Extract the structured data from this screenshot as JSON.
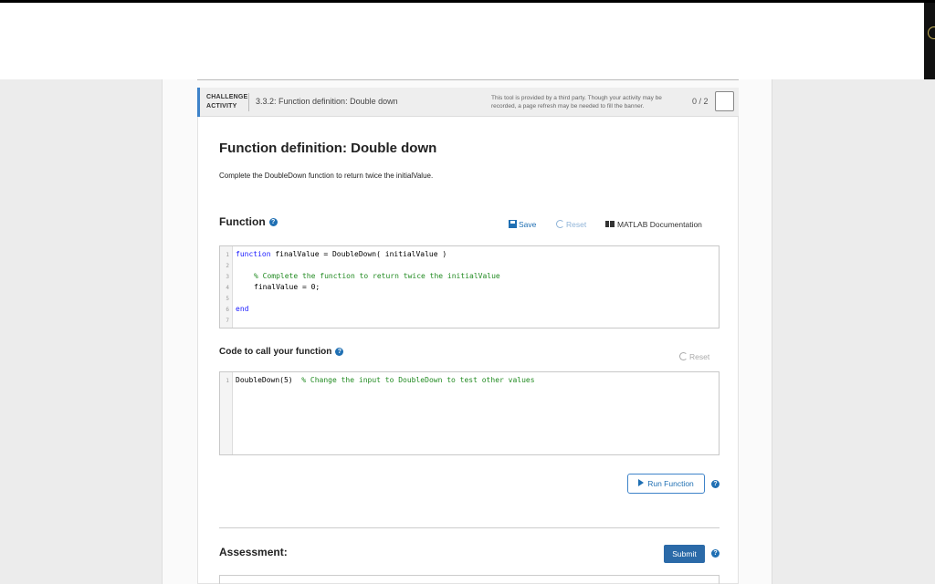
{
  "activity": {
    "type_line1": "CHALLENGE",
    "type_line2": "ACTIVITY",
    "title": "3.3.2: Function definition: Double down",
    "notice": "This tool is provided by a third party. Though your activity may be recorded, a page refresh may be needed to fill the banner.",
    "progress": "0 / 2"
  },
  "heading": "Function definition: Double down",
  "instructions": "Complete the DoubleDown function to return twice the initialValue.",
  "function_section": {
    "label": "Function",
    "save_label": "Save",
    "reset_label": "Reset",
    "doc_label": "MATLAB Documentation",
    "line_numbers": [
      "1",
      "2",
      "3",
      "4",
      "5",
      "6",
      "7"
    ],
    "line1_kw": "function",
    "line1_rest": " finalValue = DoubleDown( initialValue )",
    "line3_comment": "% Complete the function to return twice the initialValue",
    "line4_code": "finalValue = 0;",
    "line6_kw": "end"
  },
  "call_section": {
    "label": "Code to call your function",
    "reset_label": "Reset",
    "line_numbers": [
      "1"
    ],
    "line1_code": "DoubleDown(5)",
    "line1_comment": "% Change the input to DoubleDown to test other values"
  },
  "run_label": "Run Function",
  "assessment": {
    "label": "Assessment:",
    "submit_label": "Submit"
  },
  "colors": {
    "accent": "#3e83c9",
    "link": "#1f6fb3",
    "submit_bg": "#2b6aa8",
    "keyword": "#1a1aff",
    "comment": "#228b22"
  }
}
